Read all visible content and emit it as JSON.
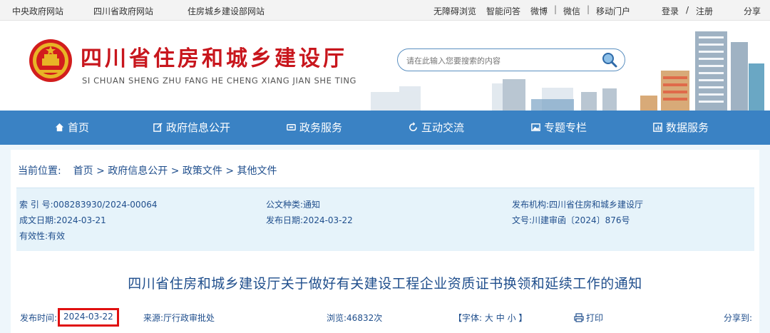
{
  "topbar": {
    "left_links": [
      "中央政府网站",
      "四川省政府网站",
      "住房城乡建设部网站"
    ],
    "right_links": {
      "accessible": "无障碍浏览",
      "ai_qa": "智能问答",
      "weibo": "微博",
      "wechat": "微信",
      "mobile": "移动门户",
      "login": "登录",
      "slash": "/",
      "register": "注册",
      "share": "分享"
    }
  },
  "header": {
    "title_cn": "四川省住房和城乡建设厅",
    "title_en": "SI CHUAN SHENG ZHU FANG HE CHENG XIANG JIAN SHE TING",
    "search_placeholder": "请在此输入您要搜索的内容"
  },
  "nav": {
    "items": [
      {
        "label": "首页",
        "icon": "home-icon"
      },
      {
        "label": "政府信息公开",
        "icon": "edit-icon"
      },
      {
        "label": "政务服务",
        "icon": "monitor-icon"
      },
      {
        "label": "互动交流",
        "icon": "refresh-icon"
      },
      {
        "label": "专题专栏",
        "icon": "image-icon"
      },
      {
        "label": "数据服务",
        "icon": "chart-icon"
      }
    ]
  },
  "breadcrumb": {
    "label": "当前位置:",
    "items": [
      "首页",
      "政府信息公开",
      "政策文件",
      "其他文件"
    ],
    "sep": ">"
  },
  "meta": {
    "index_no": "索 引 号:008283930/2024-00064",
    "doc_type": "公文种类:通知",
    "issuer": "发布机构:四川省住房和城乡建设厅",
    "created": "成文日期:2024-03-21",
    "published": "发布日期:2024-03-22",
    "doc_no": "文号:川建审函〔2024〕876号",
    "validity": "有效性:有效"
  },
  "article": {
    "title": "四川省住房和城乡建设厅关于做好有关建设工程企业资质证书换领和延续工作的通知",
    "pub_label": "发布时间:",
    "pub_date": "2024-03-22",
    "source": "来源:厅行政审批处",
    "views": "浏览:46832次",
    "font_label": "【字体:",
    "font_sizes": [
      "大",
      "中",
      "小"
    ],
    "font_end": "】",
    "print": "打印",
    "share": "分享到:"
  },
  "colors": {
    "nav_bg": "#3a82c4",
    "title_red": "#c8161d",
    "link_blue": "#1f4e8c",
    "meta_bg": "#e6f3fa",
    "highlight_red": "#e01010"
  }
}
